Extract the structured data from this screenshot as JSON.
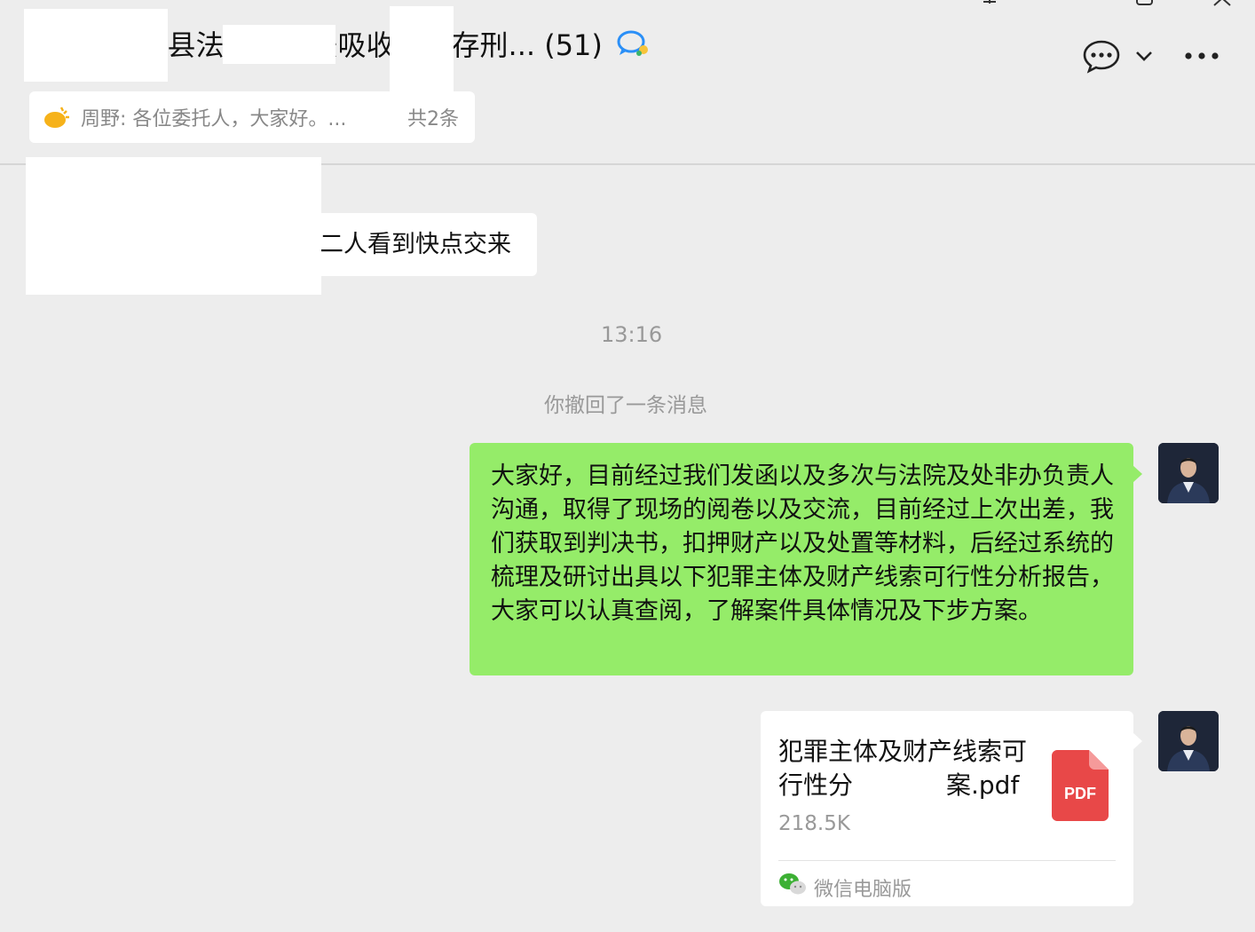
{
  "header": {
    "title": "县【 】 （ 县法院）非法吸收公众存刑... (51)",
    "pinned_message": "周野: 各位委托人，大家好。...",
    "pinned_count": "共2条",
    "icons": [
      "chat-bubble-icon",
      "chevron-down-icon",
      "more-icon",
      "group-chat-icon",
      "pin-sun-icon"
    ]
  },
  "messages": {
    "incoming_text": "二人看到快点交来",
    "time": "13:16",
    "system_notice": "你撤回了一条消息",
    "outgoing_text": "大家好，目前经过我们发函以及多次与法院及处非办负责人沟通，取得了现场的阅卷以及交流，目前经过上次出差，我们获取到判决书，扣押财产以及处置等材料，后经过系统的梳理及研讨出具以下犯罪主体及财产线索可行性分析报告，大家可以认真查阅，了解案件具体情况及下步方案。",
    "file": {
      "name_line1": "犯罪主体及财产线索可",
      "name_line2": "行性分",
      "name_line2_end": "案.pdf",
      "size": "218.5K",
      "type_label": "PDF",
      "source": "微信电脑版"
    }
  },
  "colors": {
    "background": "#ededed",
    "outgoing_bubble": "#95ec69",
    "pdf_red": "#e84848",
    "pin_yellow": "#f6b21a"
  }
}
